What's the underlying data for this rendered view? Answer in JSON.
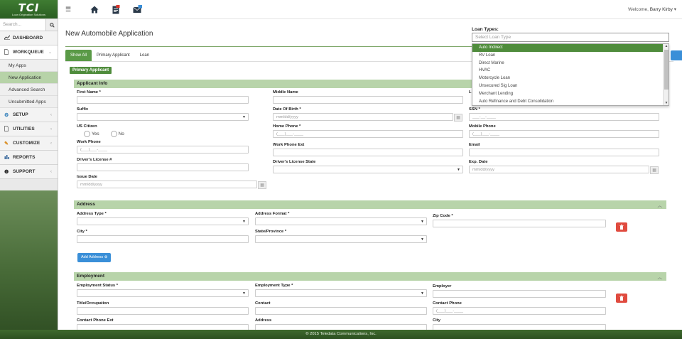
{
  "brand": {
    "logo_text": "TCI",
    "logo_sub": "Loan Origination Solutions"
  },
  "sidebar": {
    "search_placeholder": "Search...",
    "items": [
      {
        "label": "DASHBOARD",
        "icon": "chart-icon",
        "chevron": false
      },
      {
        "label": "WORKQUEUE",
        "icon": "file-icon",
        "chevron": true
      },
      {
        "label": "SETUP",
        "icon": "gear-icon",
        "chevron": true
      },
      {
        "label": "UTILITIES",
        "icon": "file-icon",
        "chevron": true
      },
      {
        "label": "CUSTOMIZE",
        "icon": "wrench-icon",
        "chevron": true
      },
      {
        "label": "REPORTS",
        "icon": "bar-chart-icon",
        "chevron": false
      },
      {
        "label": "SUPPORT",
        "icon": "info-icon",
        "chevron": true
      }
    ],
    "workqueue_sub": [
      "My Apps",
      "New Application",
      "Advanced Search",
      "Unsubmitted Apps"
    ],
    "active_sub": "New Application"
  },
  "topbar": {
    "welcome": "Welcome,",
    "user": "Barry Kirby",
    "icons": [
      "menu-icon",
      "home-icon",
      "document-badge-icon",
      "mail-badge-icon"
    ]
  },
  "page": {
    "title": "New Automobile Application",
    "tabs": [
      "Show All",
      "Primary Applicant",
      "Loan"
    ],
    "active_tab": "Show All",
    "badge": "Primary Applicant"
  },
  "loan_types": {
    "label": "Loan Types:",
    "placeholder": "Select Loan Type",
    "options": [
      "Auto Indirect",
      "RV Loan",
      "Direct Marine",
      "HVAC",
      "Motorcycle Loan",
      "Unsecured Sig Loan",
      "Merchant Lending",
      "Auto Refinance and Debt Consolidation"
    ],
    "highlighted": "Auto Indirect"
  },
  "applicant_info": {
    "header": "Applicant Info",
    "first_name": "First Name *",
    "middle_name": "Middle Name",
    "last_name_partial": "L",
    "suffix": "Suffix",
    "dob": "Date Of Birth *",
    "dob_placeholder": "mm/dd/yyyy",
    "ssn": "SSN *",
    "ssn_placeholder": "___-__-____",
    "us_citizen": "US Citizen",
    "yes": "Yes",
    "no": "No",
    "home_phone": "Home Phone *",
    "phone_placeholder": "(___)___-____",
    "mobile_phone": "Mobile Phone",
    "work_phone": "Work Phone",
    "work_phone_ext": "Work Phone Ext",
    "email": "Email",
    "drivers_license": "Driver's License #",
    "dl_state": "Driver's License State",
    "exp_date": "Exp. Date",
    "issue_date": "Issue Date"
  },
  "address": {
    "header": "Address",
    "address_type": "Address Type *",
    "address_format": "Address Format *",
    "zip": "Zip Code *",
    "city": "City *",
    "state": "State/Province *",
    "add_button": "Add Address"
  },
  "employment": {
    "header": "Employment",
    "status": "Employment Status *",
    "type": "Employment Type *",
    "employer": "Employer",
    "title": "Title/Occupation",
    "contact": "Contact",
    "contact_phone": "Contact Phone",
    "contact_phone_ext": "Contact Phone Ext",
    "address": "Address",
    "city": "City"
  },
  "footer": {
    "text": "© 2015 Teledata Communications, Inc."
  },
  "colors": {
    "brand_green": "#4f8c3c",
    "section_green": "#b8d4aa",
    "danger": "#e04b3f",
    "primary_blue": "#3a8fd8"
  }
}
